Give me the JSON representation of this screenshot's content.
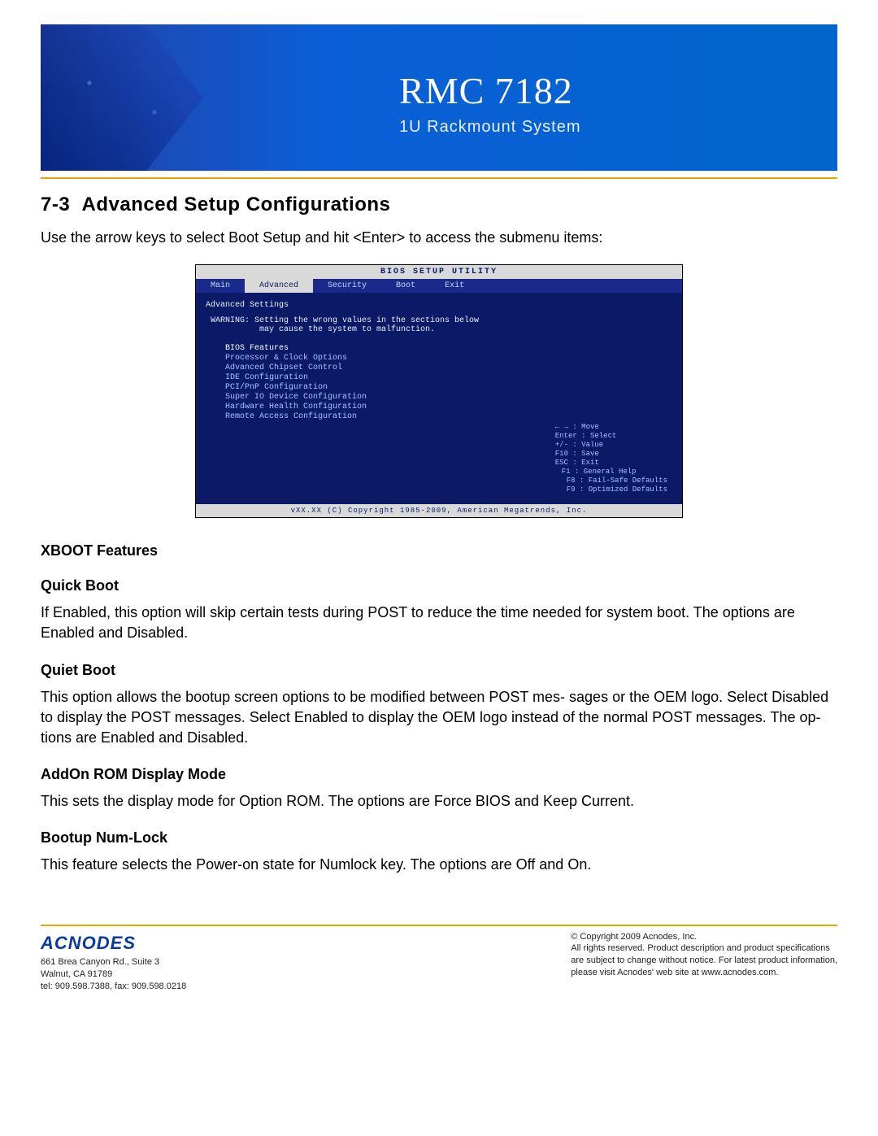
{
  "banner": {
    "title": "RMC 7182",
    "subtitle": "1U Rackmount System"
  },
  "section": {
    "number": "7-3",
    "title": "Advanced Setup Configurations",
    "intro": "Use the arrow keys to select Boot Setup and hit <Enter> to access the submenu items:"
  },
  "bios": {
    "titlebar": "BIOS SETUP UTILITY",
    "tabs": [
      "Main",
      "Advanced",
      "Security",
      "Boot",
      "Exit"
    ],
    "active_tab_index": 1,
    "heading": "Advanced Settings",
    "warning_line1": "WARNING: Setting the wrong values in the sections below",
    "warning_line2": "may cause the system to malfunction.",
    "menu": [
      "BIOS Features",
      "Processor & Clock Options",
      "Advanced Chipset Control",
      "IDE Configuration",
      "PCI/PnP Configuration",
      "Super IO Device Configuration",
      "Hardware Health Configuration",
      "Remote Access Configuration"
    ],
    "help": [
      "← → : Move",
      "Enter : Select",
      "+/- : Value",
      "F10 : Save",
      "ESC : Exit",
      "F1 : General Help",
      "F8 : Fail-Safe Defaults",
      "F9 : Optimized Defaults"
    ],
    "footer": "vXX.XX (C) Copyright 1985-2009, American Megatrends, Inc."
  },
  "features": [
    {
      "title": "XBOOT  Features",
      "body": ""
    },
    {
      "title": "Quick Boot",
      "body": "If Enabled, this option will skip certain tests during POST to reduce the time needed for system boot. The options are Enabled and Disabled."
    },
    {
      "title": "Quiet Boot",
      "body": "This option allows the bootup screen options to be modified between POST mes- sages or the OEM logo. Select Disabled to display the POST messages. Select Enabled to display the OEM logo instead of the normal POST messages. The op- tions are Enabled and Disabled."
    },
    {
      "title": "AddOn ROM Display Mode",
      "body": "This sets the display mode for Option ROM.  The options are Force BIOS and Keep Current."
    },
    {
      "title": "Bootup Num-Lock",
      "body": "This feature selects the Power-on state for Numlock key.   The options are Off and On."
    }
  ],
  "footer": {
    "logo": "ACNODES",
    "addr1": "661 Brea Canyon Rd., Suite 3",
    "addr2": "Walnut, CA 91789",
    "phone": "tel: 909.598.7388, fax: 909.598.0218",
    "copy": "© Copyright 2009 Acnodes, Inc.",
    "legal1": "All rights reserved. Product description and product specifications",
    "legal2": "are subject to change without notice. For latest product information,",
    "legal3": "please visit Acnodes' web site at www.acnodes.com."
  }
}
